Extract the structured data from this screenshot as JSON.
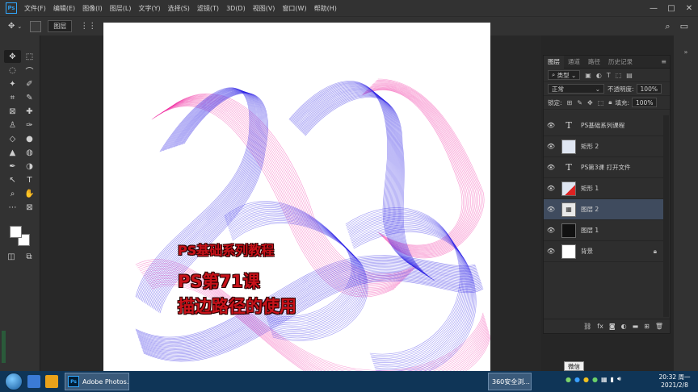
{
  "app": {
    "logo_text": "Ps"
  },
  "menu": [
    "文件(F)",
    "编辑(E)",
    "图像(I)",
    "图层(L)",
    "文字(Y)",
    "选择(S)",
    "滤镜(T)",
    "3D(D)",
    "视图(V)",
    "窗口(W)",
    "帮助(H)"
  ],
  "window_controls": {
    "minimize": "—",
    "maximize": "□",
    "close": "✕"
  },
  "options_bar": {
    "select_label": "图层"
  },
  "canvas": {
    "title_small": "PS基础系列教程",
    "title_line2": "PS第71课",
    "title_line3": "描边路径的使用",
    "colors": {
      "blue": "#2a1ee6",
      "magenta": "#f01a9a",
      "text_red": "#c8121a"
    }
  },
  "layers_panel": {
    "tabs": [
      "图层",
      "通道",
      "路径",
      "历史记录"
    ],
    "filter_label": "类型",
    "blend_mode": "正常",
    "opacity_label": "不透明度:",
    "opacity_value": "100%",
    "lock_label": "锁定:",
    "fill_label": "填充:",
    "fill_value": "100%",
    "layers": [
      {
        "name": "PS基础系列课程",
        "type": "text",
        "selected": false
      },
      {
        "name": "矩形 2",
        "type": "shape",
        "selected": false
      },
      {
        "name": "PS第3课 打开文件",
        "type": "text",
        "selected": false
      },
      {
        "name": "矩形 1",
        "type": "shape",
        "selected": false
      },
      {
        "name": "图层 2",
        "type": "pixel",
        "selected": true
      },
      {
        "name": "图层 1",
        "type": "pixel-dark",
        "selected": false
      },
      {
        "name": "背景",
        "type": "background",
        "selected": false,
        "locked": true
      }
    ],
    "bottom_icons": [
      "link-icon",
      "fx-icon",
      "mask-icon",
      "adjustment-icon",
      "folder-icon",
      "new-layer-icon",
      "trash-icon"
    ]
  },
  "tooltip": "微信",
  "taskbar": {
    "ps_task_label": "Adobe Photos...",
    "task_360_label": "360安全浏...",
    "time": "20:32 周一",
    "date": "2021/2/8"
  }
}
